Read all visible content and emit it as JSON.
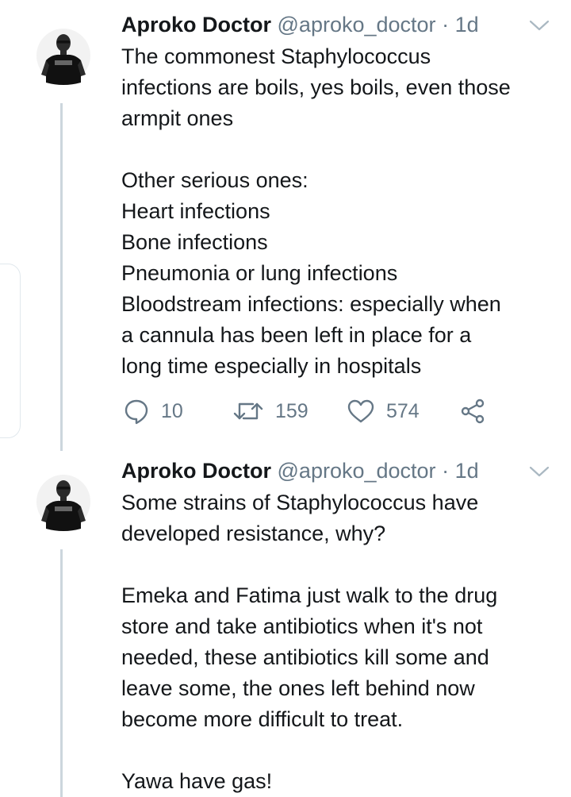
{
  "tweets": [
    {
      "name": "Aproko Doctor",
      "handle": "@aproko_doctor",
      "separator": "·",
      "time": "1d",
      "avatar_icon": "profile-photo-man-in-black-tshirt",
      "text": "The commonest Staphylococcus\ninfections are boils, yes boils, even those\narmpit ones\n\nOther serious ones:\nHeart infections\nBone infections\nPneumonia or lung infections\nBloodstream infections: especially when\na cannula has been left in place for a\nlong time especially in hospitals",
      "replies": "10",
      "retweets": "159",
      "likes": "574"
    },
    {
      "name": "Aproko Doctor",
      "handle": "@aproko_doctor",
      "separator": "·",
      "time": "1d",
      "avatar_icon": "profile-photo-man-in-black-tshirt",
      "text": "Some strains of Staphylococcus have\ndeveloped resistance, why?\n\nEmeka and Fatima just walk to the drug\nstore and take antibiotics when it's not\nneeded, these antibiotics kill some and\nleave some, the ones left behind now\nbecome more difficult to treat.\n\nYawa have gas!"
    }
  ],
  "colors": {
    "text": "#14171a",
    "secondary": "#657786",
    "thread_line": "#ccd6dd"
  },
  "icons": [
    "reply-icon",
    "retweet-icon",
    "like-icon",
    "share-icon",
    "chevron-down-icon"
  ]
}
